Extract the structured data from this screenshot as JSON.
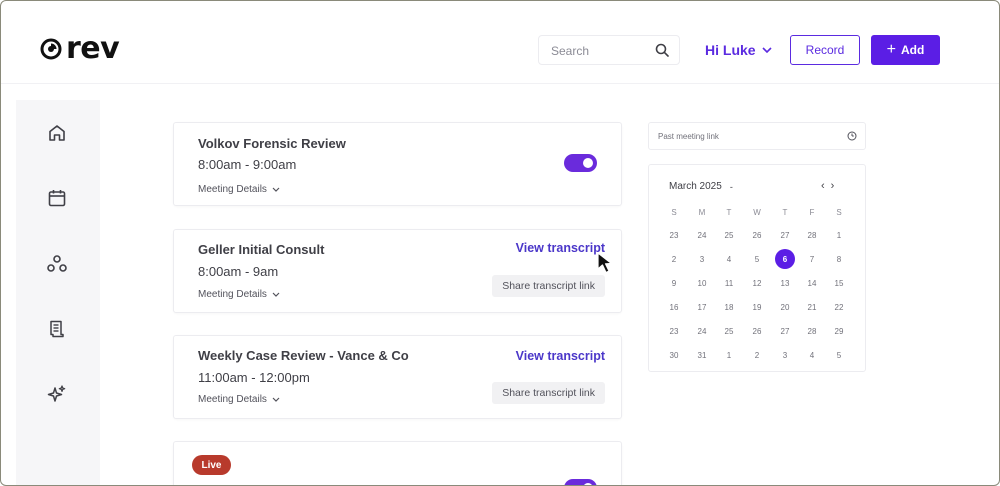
{
  "brand": {
    "name": "rev"
  },
  "header": {
    "search_placeholder": "Search",
    "greeting": "Hi Luke",
    "record_label": "Record",
    "add_label": "Add"
  },
  "sidebar": {
    "icons": [
      "home-icon",
      "calendar-icon",
      "circles-icon",
      "document-icon",
      "sparkle-icon"
    ]
  },
  "meetings": [
    {
      "title": "Volkov Forensic Review",
      "time": "8:00am - 9:00am",
      "details_label": "Meeting Details",
      "toggle_on": true
    },
    {
      "title": "Geller Initial Consult",
      "time": "8:00am - 9am",
      "details_label": "Meeting Details",
      "view_label": "View transcript",
      "share_label": "Share transcript link"
    },
    {
      "title": "Weekly Case Review - Vance & Co",
      "time": "11:00am - 12:00pm",
      "details_label": "Meeting Details",
      "view_label": "View transcript",
      "share_label": "Share transcript link"
    },
    {
      "badge": "Live",
      "toggle_on": true
    }
  ],
  "meeting_link": {
    "placeholder": "Past meeting link"
  },
  "calendar": {
    "month": "March 2025",
    "caret": "-",
    "prev": "‹",
    "next": "›",
    "weekdays": [
      "S",
      "M",
      "T",
      "W",
      "T",
      "F",
      "S"
    ],
    "weeks": [
      [
        "23",
        "24",
        "25",
        "26",
        "27",
        "28",
        "1"
      ],
      [
        "2",
        "3",
        "4",
        "5",
        "6",
        "7",
        "8"
      ],
      [
        "9",
        "10",
        "11",
        "12",
        "13",
        "14",
        "15"
      ],
      [
        "16",
        "17",
        "18",
        "19",
        "20",
        "21",
        "22"
      ],
      [
        "23",
        "24",
        "25",
        "26",
        "27",
        "28",
        "29"
      ],
      [
        "30",
        "31",
        "1",
        "2",
        "3",
        "4",
        "5"
      ]
    ],
    "selected": "6"
  },
  "colors": {
    "accent": "#5b1ee5",
    "link": "#4b37c9",
    "live": "#b83a2c"
  }
}
